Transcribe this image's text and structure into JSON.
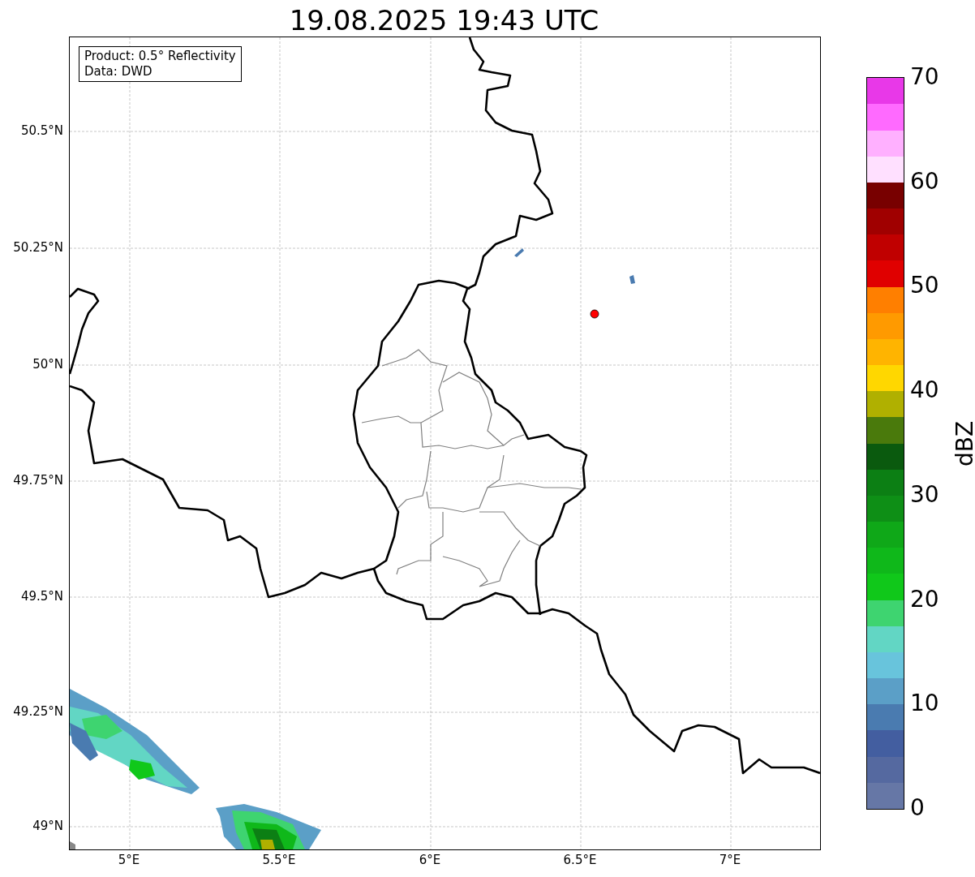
{
  "title": "19.08.2025 19:43 UTC",
  "info_box": [
    "Product: 0.5° Reflectivity",
    "Data: DWD"
  ],
  "map": {
    "lat_ticks": [
      "50.5°N",
      "50.25°N",
      "50°N",
      "49.75°N",
      "49.5°N",
      "49.25°N",
      "49°N"
    ],
    "lon_ticks": [
      "5°E",
      "5.5°E",
      "6°E",
      "6.5°E",
      "7°E"
    ]
  },
  "colorbar": {
    "label": "dBZ",
    "ticks": [
      "70",
      "60",
      "50",
      "40",
      "30",
      "20",
      "10",
      "0"
    ],
    "bands": [
      {
        "color": "#6677a6"
      },
      {
        "color": "#5569a0"
      },
      {
        "color": "#435ea0"
      },
      {
        "color": "#4a7bb0"
      },
      {
        "color": "#5b9fc7"
      },
      {
        "color": "#68c4dc"
      },
      {
        "color": "#62d6c4"
      },
      {
        "color": "#3ed470"
      },
      {
        "color": "#10c81a"
      },
      {
        "color": "#0fb81a"
      },
      {
        "color": "#0fa818"
      },
      {
        "color": "#0e8f16"
      },
      {
        "color": "#0c7f14"
      },
      {
        "color": "#0a5a0e"
      },
      {
        "color": "#4a7a0c"
      },
      {
        "color": "#b0b000"
      },
      {
        "color": "#ffd700"
      },
      {
        "color": "#ffb400"
      },
      {
        "color": "#ff9a00"
      },
      {
        "color": "#ff7f00"
      },
      {
        "color": "#e00000"
      },
      {
        "color": "#c00000"
      },
      {
        "color": "#a00000"
      },
      {
        "color": "#780000"
      },
      {
        "color": "#ffe0ff"
      },
      {
        "color": "#ffb0ff"
      },
      {
        "color": "#ff6aff"
      },
      {
        "color": "#e838e8"
      }
    ]
  }
}
